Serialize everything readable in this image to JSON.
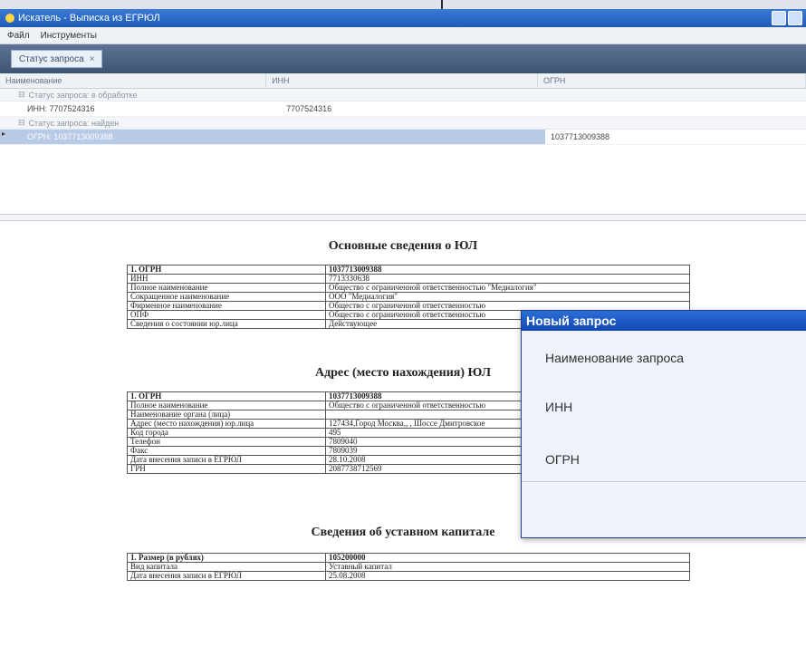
{
  "window": {
    "title": "Искатель - Выписка из ЕГРЮЛ"
  },
  "menu": [
    "Файл",
    "Инструменты"
  ],
  "grouping": {
    "chip_label": "Статус запроса",
    "chip_close": "×"
  },
  "grid": {
    "columns": [
      "Наименование",
      "ИНН",
      "ОГРН"
    ],
    "groups": [
      {
        "label": "Статус запроса: в обработке",
        "rows": [
          {
            "name": "ИНН: 7707524316",
            "inn": "7707524316",
            "ogrn": ""
          }
        ]
      },
      {
        "label": "Статус запроса: найден",
        "rows": [
          {
            "name": "ОГРН: 1037713009388",
            "inn": "",
            "ogrn": "1037713009388"
          }
        ]
      }
    ]
  },
  "document": {
    "section1": {
      "title": "Основные сведения о ЮЛ",
      "rows": [
        [
          "1. ОГРН",
          "1037713009388"
        ],
        [
          "ИНН",
          "7713330638"
        ],
        [
          "Полное наименование",
          "Общество с ограниченной ответственностью \"Медиалогия\""
        ],
        [
          "Сокращенное наименование",
          "ООО \"Медиалогия\""
        ],
        [
          "Фирменное наименование",
          "Общество с ограниченной ответственностью"
        ],
        [
          "ОПФ",
          "Общество с ограниченной ответственностью"
        ],
        [
          "Сведения о состоянии юр.лица",
          "Действующее"
        ]
      ]
    },
    "section2": {
      "title": "Адрес (место нахождения) ЮЛ",
      "rows": [
        [
          "1. ОГРН",
          "1037713009388"
        ],
        [
          "Полное наименование",
          "Общество с ограниченной ответственностью"
        ],
        [
          "Наименование органа (лица)",
          ""
        ],
        [
          "Адрес (место нахождения) юр.лица",
          "127434,Город Москва,, , Шоссе Дмитровское"
        ],
        [
          "Код города",
          "495"
        ],
        [
          "Телефон",
          "7809040"
        ],
        [
          "Факс",
          "7809039"
        ],
        [
          "Дата внесения записи в ЕГРЮЛ",
          "28.10.2008"
        ],
        [
          "ГРН",
          "2087738712569"
        ]
      ]
    },
    "section3": {
      "title": "Сведения об уставном капитале",
      "rows": [
        [
          "1. Размер (в рублях)",
          "105200000"
        ],
        [
          "Вид капитала",
          "Уставный капитал"
        ],
        [
          "Дата внесения записи в ЕГРЮЛ",
          "25.08.2008"
        ]
      ]
    }
  },
  "dialog": {
    "title": "Новый запрос",
    "labels": [
      "Наименование запроса",
      "ИНН",
      "ОГРН"
    ]
  }
}
